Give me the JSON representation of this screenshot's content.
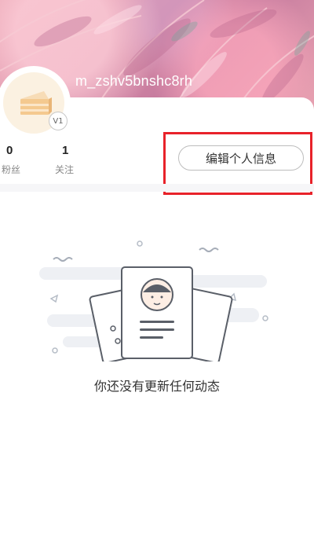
{
  "profile": {
    "username": "m_zshv5bnshc8rh",
    "level_badge": "V1"
  },
  "stats": {
    "fans_count": "0",
    "fans_label": "粉丝",
    "following_count": "1",
    "following_label": "关注"
  },
  "actions": {
    "edit_profile_label": "编辑个人信息"
  },
  "feed": {
    "empty_message": "你还没有更新任何动态"
  },
  "colors": {
    "highlight": "#e8222a",
    "banner": "#d98ca6"
  }
}
